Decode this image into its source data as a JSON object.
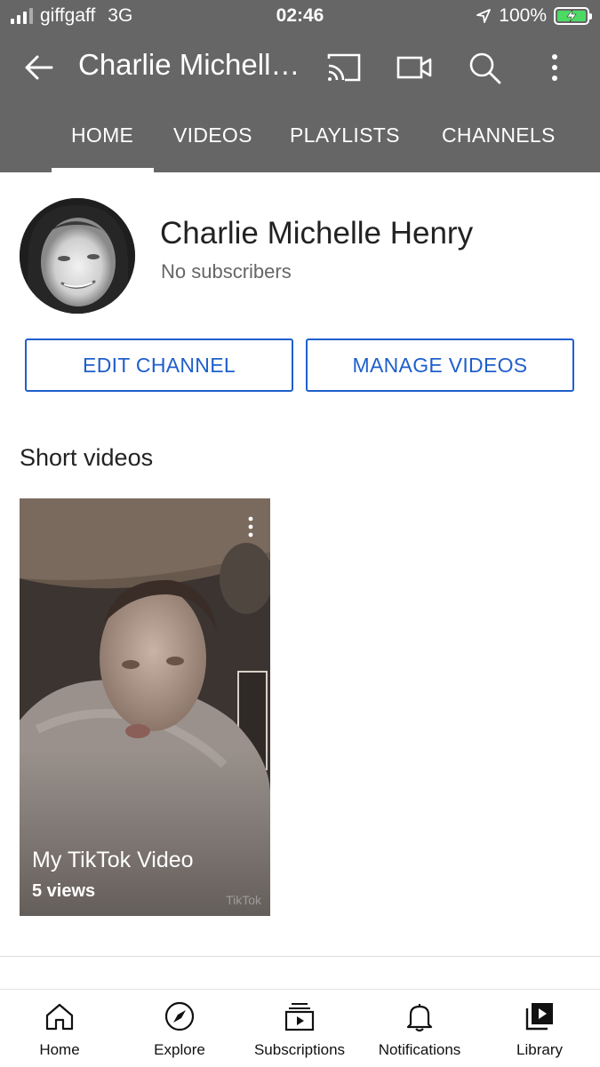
{
  "status_bar": {
    "carrier": "giffgaff",
    "network": "3G",
    "time": "02:46",
    "battery": "100%",
    "signal_bars": 3,
    "signal_total": 4
  },
  "appbar": {
    "title": "Charlie Michell…",
    "icons": [
      "back-arrow-icon",
      "cast-icon",
      "video-camera-icon",
      "search-icon",
      "more-vertical-icon"
    ]
  },
  "tabs": [
    {
      "label": "HOME",
      "active": true
    },
    {
      "label": "VIDEOS",
      "active": false
    },
    {
      "label": "PLAYLISTS",
      "active": false
    },
    {
      "label": "CHANNELS",
      "active": false
    }
  ],
  "channel": {
    "name": "Charlie Michelle Henry",
    "subscribers": "No subscribers"
  },
  "buttons": {
    "edit": "EDIT CHANNEL",
    "manage": "MANAGE VIDEOS"
  },
  "shorts": {
    "section_title": "Short videos",
    "items": [
      {
        "title": "My TikTok Video",
        "views": "5 views",
        "watermark": "TikTok"
      }
    ]
  },
  "bottom_nav": [
    {
      "label": "Home",
      "icon": "home-icon"
    },
    {
      "label": "Explore",
      "icon": "compass-icon"
    },
    {
      "label": "Subscriptions",
      "icon": "subscriptions-icon"
    },
    {
      "label": "Notifications",
      "icon": "bell-icon"
    },
    {
      "label": "Library",
      "icon": "library-icon"
    }
  ],
  "colors": {
    "header_bg": "#666666",
    "accent_blue": "#1f5fcc",
    "battery_green": "#4cd964"
  }
}
